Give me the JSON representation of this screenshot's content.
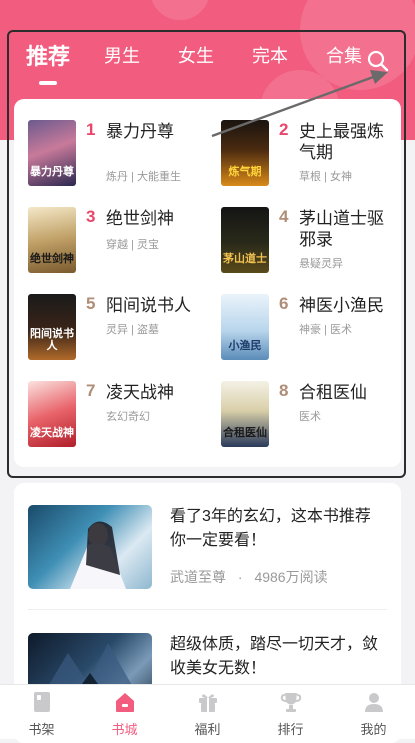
{
  "tabs": {
    "items": [
      {
        "label": "推荐"
      },
      {
        "label": "男生"
      },
      {
        "label": "女生"
      },
      {
        "label": "完本"
      },
      {
        "label": "合集"
      }
    ]
  },
  "rankings": [
    {
      "rank": "1",
      "title": "暴力丹尊",
      "tags": "炼丹 | 大能重生",
      "cover_text": "暴力丹尊"
    },
    {
      "rank": "2",
      "title": "史上最强炼气期",
      "tags": "草根 | 女神",
      "cover_text": "炼气期"
    },
    {
      "rank": "3",
      "title": "绝世剑神",
      "tags": "穿越 | 灵宝",
      "cover_text": "绝世剑神"
    },
    {
      "rank": "4",
      "title": "茅山道士驱邪录",
      "tags": "悬疑灵异",
      "cover_text": "茅山道士"
    },
    {
      "rank": "5",
      "title": "阳间说书人",
      "tags": "灵异 | 盗墓",
      "cover_text": "阳间说书人"
    },
    {
      "rank": "6",
      "title": "神医小渔民",
      "tags": "神豪 | 医术",
      "cover_text": "小渔民"
    },
    {
      "rank": "7",
      "title": "凌天战神",
      "tags": "玄幻奇幻",
      "cover_text": "凌天战神"
    },
    {
      "rank": "8",
      "title": "合租医仙",
      "tags": "医术",
      "cover_text": "合租医仙"
    }
  ],
  "recommendations": [
    {
      "title": "看了3年的玄幻，这本书推荐你一定要看！",
      "book": "武道至尊",
      "dot": "·",
      "reads": "4986万阅读"
    },
    {
      "title": "超级体质，踏尽一切天才，敛收美女无数！",
      "book": "",
      "dot": "",
      "reads": ""
    }
  ],
  "nav": {
    "items": [
      {
        "label": "书架"
      },
      {
        "label": "书城"
      },
      {
        "label": "福利"
      },
      {
        "label": "排行"
      },
      {
        "label": "我的"
      }
    ]
  },
  "colors": {
    "brand": "#f25d7f",
    "rank_top": "#e8476b",
    "rank_other": "#b08d76",
    "nav_inactive": "#555555"
  },
  "icons": {
    "search": "search-icon",
    "bookshelf": "bookshelf-icon",
    "bookstore": "home-icon",
    "welfare": "gift-icon",
    "ranking": "trophy-icon",
    "profile": "person-icon"
  }
}
